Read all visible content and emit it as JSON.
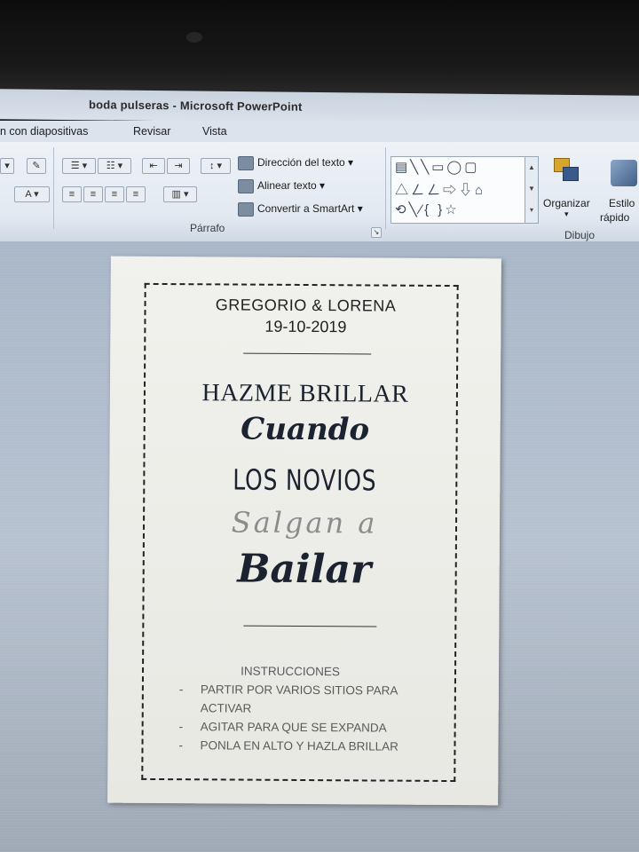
{
  "window": {
    "title": "boda pulseras - Microsoft PowerPoint"
  },
  "tabs": [
    "n con diapositivas",
    "Revisar",
    "Vista"
  ],
  "ribbon": {
    "paragraph": {
      "label": "Párrafo",
      "text_direction": "Dirección del texto",
      "align_text": "Alinear texto",
      "convert_smartart": "Convertir a SmartArt"
    },
    "drawing": {
      "label": "Dibujo",
      "arrange": "Organizar",
      "quick_styles_1": "Estilo",
      "quick_styles_2": "rápido"
    }
  },
  "slide": {
    "names": "GREGORIO & LORENA",
    "date": "19-10-2019",
    "line1": "HAZME BRILLAR",
    "line2": "Cuando",
    "line3": "LOS NOVIOS",
    "line4": "Salgan a",
    "line5": "Bailar",
    "instructions": {
      "heading": "INSTRUCCIONES",
      "item1": "PARTIR POR VARIOS SITIOS PARA",
      "item1_cont": "ACTIVAR",
      "item2": "AGITAR PARA QUE SE EXPANDA",
      "item3": "PONLA EN ALTO Y HAZLA BRILLAR"
    }
  }
}
